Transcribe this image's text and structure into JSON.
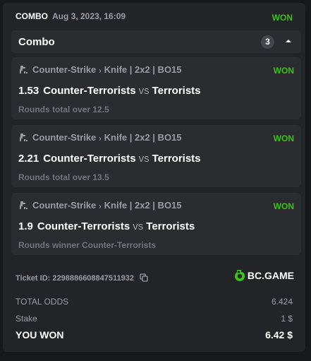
{
  "header": {
    "type": "COMBO",
    "date": "Aug 3, 2023, 16:09",
    "status": "WON"
  },
  "combo": {
    "title": "Combo",
    "count": "3"
  },
  "legs": [
    {
      "sport": "Counter-Strike",
      "separator": "›",
      "league": "Knife | 2x2 | BO15",
      "status": "WON",
      "odds": "1.53",
      "home": "Counter-Terrorists",
      "vs": "vs",
      "away": "Terrorists",
      "pick": "Rounds total over 12.5"
    },
    {
      "sport": "Counter-Strike",
      "separator": "›",
      "league": "Knife | 2x2 | BO15",
      "status": "WON",
      "odds": "2.21",
      "home": "Counter-Terrorists",
      "vs": "vs",
      "away": "Terrorists",
      "pick": "Rounds total over 13.5"
    },
    {
      "sport": "Counter-Strike",
      "separator": "›",
      "league": "Knife | 2x2 | BO15",
      "status": "WON",
      "odds": "1.9",
      "home": "Counter-Terrorists",
      "vs": "vs",
      "away": "Terrorists",
      "pick": "Rounds winner Counter-Terrorists"
    }
  ],
  "ticket": {
    "label": "Ticket ID: 2298886608847511932"
  },
  "brand": {
    "name": "BC.GAME"
  },
  "summary": {
    "total_odds_label": "TOTAL ODDS",
    "total_odds_value": "6.424",
    "stake_label": "Stake",
    "stake_value": "1 $",
    "won_label": "YOU WON",
    "won_value": "6.42 $"
  },
  "colors": {
    "won": "#3bc117",
    "background": "#17181c",
    "card": "#232427",
    "row": "#2b2c30"
  },
  "icons": {
    "sport": "counter-strike-icon",
    "collapse": "chevron-up-icon",
    "copy": "copy-icon",
    "brand": "bc-game-logo-icon"
  }
}
